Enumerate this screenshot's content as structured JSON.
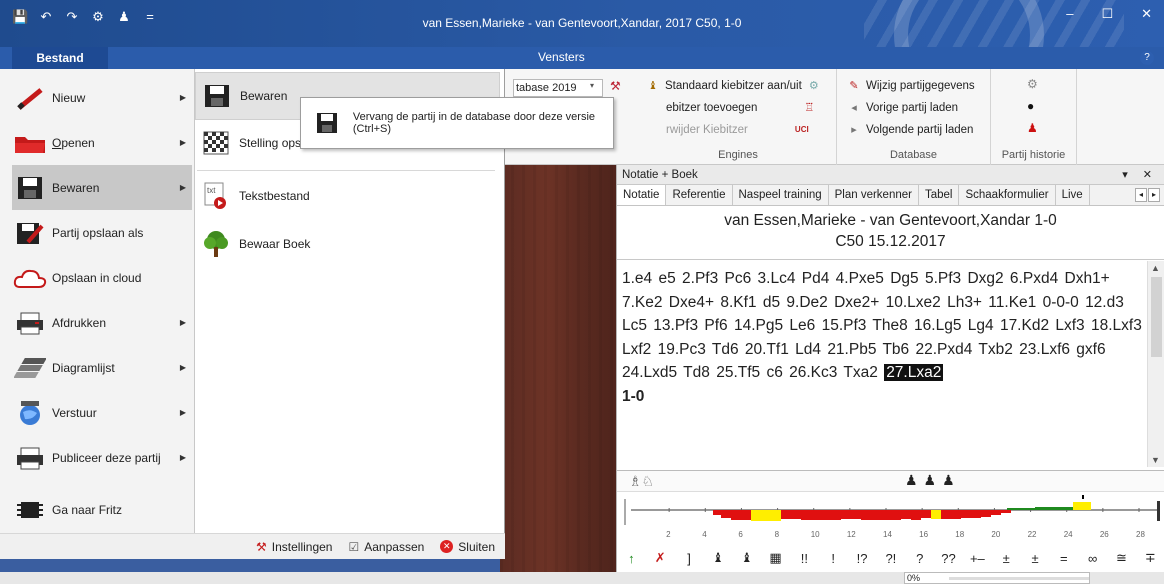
{
  "window": {
    "title": "van Essen,Marieke - van Gentevoort,Xandar,  2017  C50, 1-0",
    "controls": {
      "minimize": "–",
      "maximize": "☐",
      "close": "✕"
    },
    "quick_access": [
      "💾",
      "↶",
      "↷",
      "⚙",
      "♟",
      "="
    ]
  },
  "tabs": {
    "file": "Bestand",
    "windows": "Vensters",
    "help": "?"
  },
  "ribbon": {
    "db_combo": "tabase 2019",
    "engines": {
      "label": "Engines",
      "items": [
        "Standaard kiebitzer aan/uit",
        "ebitzer toevoegen",
        "rwijder Kiebitzer"
      ]
    },
    "database": {
      "label": "Database",
      "items": [
        "Wijzig partijgegevens",
        "Vorige partij laden",
        "Volgende partij laden"
      ]
    },
    "history": {
      "label": "Partij historie"
    }
  },
  "file_menu": {
    "items": [
      {
        "label": "Nieuw",
        "has_sub": true
      },
      {
        "label": "Openen",
        "underline": "O",
        "rest": "penen",
        "has_sub": true
      },
      {
        "label": "Bewaren",
        "has_sub": true
      },
      {
        "label": "Partij opslaan als",
        "has_sub": false
      },
      {
        "label": "Opslaan in cloud",
        "has_sub": false
      },
      {
        "label": "Afdrukken",
        "has_sub": true
      },
      {
        "label": "Diagramlijst",
        "has_sub": true
      },
      {
        "label": "Verstuur",
        "has_sub": true
      },
      {
        "label": "Publiceer deze partij",
        "has_sub": true
      },
      {
        "label": "Ga naar Fritz",
        "has_sub": false
      }
    ]
  },
  "submenu": {
    "items": [
      {
        "label": "Bewaren"
      },
      {
        "label": "Stelling ops"
      },
      {
        "label": "Tekstbestand"
      },
      {
        "label": "Bewaar Boek"
      }
    ],
    "txt_icon_label": "txt"
  },
  "tooltip": {
    "text": "Vervang de partij in de database door deze versie (Ctrl+S)"
  },
  "menu_footer": {
    "settings": "Instellingen",
    "customize": "Aanpassen",
    "close": "Sluiten"
  },
  "notation": {
    "panel_title": "Notatie + Boek",
    "panel_controls": "▾ ✕",
    "tabs": [
      "Notatie",
      "Referentie",
      "Naspeel training",
      "Plan verkenner",
      "Tabel",
      "Schaakformulier",
      "Live"
    ],
    "players": "van Essen,Marieke - van Gentevoort,Xandar  1-0",
    "eco_date": "C50  15.12.2017",
    "moves_text": "1.e4 e5 2.Pf3 Pc6 3.Lc4 Pd4 4.Pxe5 Dg5 5.Pf3 Dxg2 6.Pxd4 Dxh1+ 7.Ke2 Dxe4+ 8.Kf1 d5 9.De2 Dxe2+ 10.Lxe2 Lh3+ 11.Ke1 0-0-0 12.d3 Lc5 13.Pf3 Pf6 14.Pg5 Le6 15.Pf3 The8 16.Lg5 Lg4 17.Kd2 Lxf3 18.Lxf3 Lxf2 19.Pc3 Td6 20.Tf1 Ld4 21.Pb5 Tb6 22.Pxd4 Txb2 23.Lxf6 gxf6 24.Lxd5 Td8 25.Tf5 c6 26.Kc3 Txa2",
    "current_move": "27.Lxa2",
    "result": "1-0",
    "white_pieces": "♗♘",
    "black_pieces": "♟♟♟",
    "graph_ticks": [
      "2",
      "4",
      "6",
      "8",
      "10",
      "12",
      "14",
      "16",
      "18",
      "20",
      "22",
      "24",
      "26",
      "28"
    ],
    "annotation_symbols": [
      "↑",
      "✗",
      "]",
      "♝",
      "♝",
      "▦",
      "!!",
      "!",
      "!?",
      "?!",
      "?",
      "??",
      "+–",
      "±",
      "±",
      "=",
      "∞",
      "≅",
      "∓"
    ]
  },
  "status": {
    "progress": "0%"
  },
  "colors": {
    "titlebar": "#1f4b8e",
    "tab_active": "#1e4a93",
    "graph_red": "#e01010",
    "graph_yellow": "#ffee00",
    "graph_green": "#1f8a1f"
  }
}
